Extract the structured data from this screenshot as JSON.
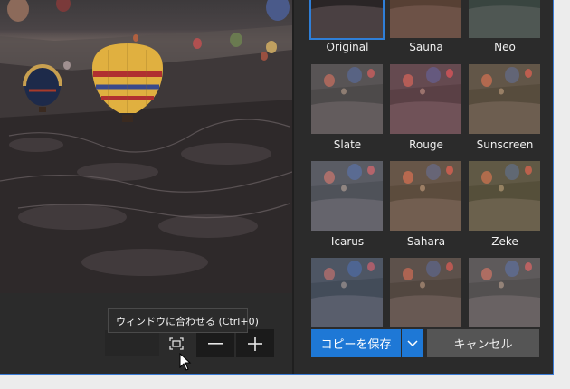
{
  "editor": {
    "tooltip": "ウィンドウに合わせる (Ctrl+0)",
    "zoom_out_icon": "minus-icon",
    "zoom_in_icon": "plus-icon",
    "fit_icon": "fit-to-window-icon"
  },
  "filters": [
    {
      "label": "Original",
      "selected": true,
      "tint": "#ffffff"
    },
    {
      "label": "Sauna",
      "selected": false,
      "tint": "#b87a55"
    },
    {
      "label": "Neo",
      "selected": false,
      "tint": "#5a8a7a"
    },
    {
      "label": "Slate",
      "selected": false,
      "tint": "#999999"
    },
    {
      "label": "Rouge",
      "selected": false,
      "tint": "#c07a8a"
    },
    {
      "label": "Sunscreen",
      "selected": false,
      "tint": "#b8a070"
    },
    {
      "label": "Icarus",
      "selected": false,
      "tint": "#a0b0c8"
    },
    {
      "label": "Sahara",
      "selected": false,
      "tint": "#c8a070"
    },
    {
      "label": "Zeke",
      "selected": false,
      "tint": "#b0a868"
    },
    {
      "label": "",
      "selected": false,
      "tint": "#7aa0c8"
    },
    {
      "label": "",
      "selected": false,
      "tint": "#a89078"
    },
    {
      "label": "",
      "selected": false,
      "tint": "#aaaaaa"
    }
  ],
  "actions": {
    "save_label": "コピーを保存",
    "cancel_label": "キャンセル"
  },
  "colors": {
    "accent": "#1e78d6",
    "panel_bg": "#2b2b2b"
  }
}
